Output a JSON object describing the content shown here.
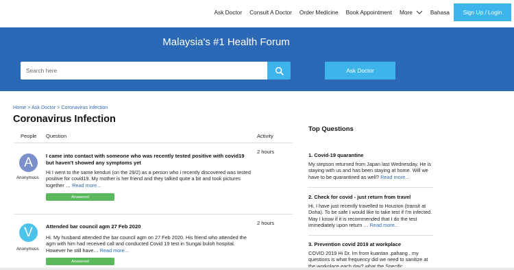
{
  "nav": {
    "links": [
      "Ask Doctor",
      "Consult A Doctor",
      "Order Medicine",
      "Book Appointment"
    ],
    "more_label": "More",
    "language_label": "Bahasa",
    "signup_label": "Sign Up / Login"
  },
  "hero": {
    "title": "Malaysia's #1 Health Forum",
    "search_placeholder": "Search here",
    "ask_button_label": "Ask Doctor"
  },
  "breadcrumb": [
    "Home",
    "Ask Doctor",
    "Coronavirus Infection"
  ],
  "breadcrumb_separator": " > ",
  "page_title": "Coronavirus Infection",
  "table_headers": {
    "people": "People",
    "question": "Question",
    "activity": "Activity"
  },
  "questions": [
    {
      "avatar_letter": "A",
      "avatar_color": "#7b8fcb",
      "author": "Anonymous",
      "title": "I came into contact with someone who was recently tested positive with covid19 but haven't showed any symptoms yet",
      "excerpt": "Hi I went to the same kenduri (on the 29/2) as a person who i recently discovered was tested positive for covid19. My mother is her friend and they talked quite a bit and took pictures together …",
      "read_more": "Read more...",
      "status": "Answered",
      "activity": "2 hours"
    },
    {
      "avatar_letter": "V",
      "avatar_color": "#4cc3ea",
      "author": "Anonymous",
      "title": "Attended bar council agm 27 Feb 2020",
      "excerpt": "Hi. My husband attended the bar council agm on 27 Feb 2020. His friend who attended the agm with him had received call and conducted Covid 19 test in Sungai buloh hospital. However he still have…",
      "read_more": "Read more...",
      "status": "Answered",
      "activity": "2 hours"
    }
  ],
  "sidebar": {
    "title": "Top Questions",
    "items": [
      {
        "title": "1. Covid-19 quarantine",
        "excerpt": "My stepson returned from Japan last Wednesday. He is staying with us and has been staying at home. Will we have to be quarantined as well?",
        "read_more": "Read more..."
      },
      {
        "title": "2. Check for covid - just return from travel",
        "excerpt": "Hi, I have just recently travelled to Houston (transit at Doha). To be safe I would like to take test if I'm infected. May I know if it is recommended that I do the test immediately upon return …",
        "read_more": "Read more..."
      },
      {
        "title": "3. Prevention covid 2019 at workplace",
        "excerpt": "COVID 2019 Hi Dr. Im from kuantan ,pahang . my questions is what frequency did we need to sanitize at the workplace each day? what the Specific",
        "read_more": ""
      }
    ]
  },
  "colors": {
    "brand_blue": "#2b69b6",
    "accent_cyan": "#3db5ea",
    "answered_green": "#5cb85c"
  }
}
